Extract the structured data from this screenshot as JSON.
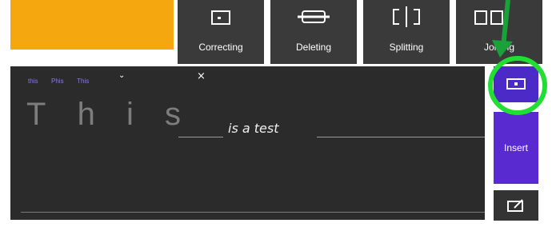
{
  "toolbar": {
    "tabs": [
      {
        "label": "Correcting",
        "icon": "box-icon"
      },
      {
        "label": "Deleting",
        "icon": "strike-icon"
      },
      {
        "label": "Splitting",
        "icon": "split-icon"
      },
      {
        "label": "Joining",
        "icon": "join-icon"
      }
    ]
  },
  "panel": {
    "suggestions": [
      "this",
      "Phis",
      "This"
    ],
    "close": "×",
    "chevron": "⌄",
    "big_word": [
      "T",
      "h",
      "i",
      "s"
    ],
    "handwriting": "is a test"
  },
  "side": {
    "insert_label": "Insert"
  },
  "colors": {
    "accent": "#5a2ad1",
    "highlight": "#22dd33",
    "orange": "#f4a70f"
  }
}
